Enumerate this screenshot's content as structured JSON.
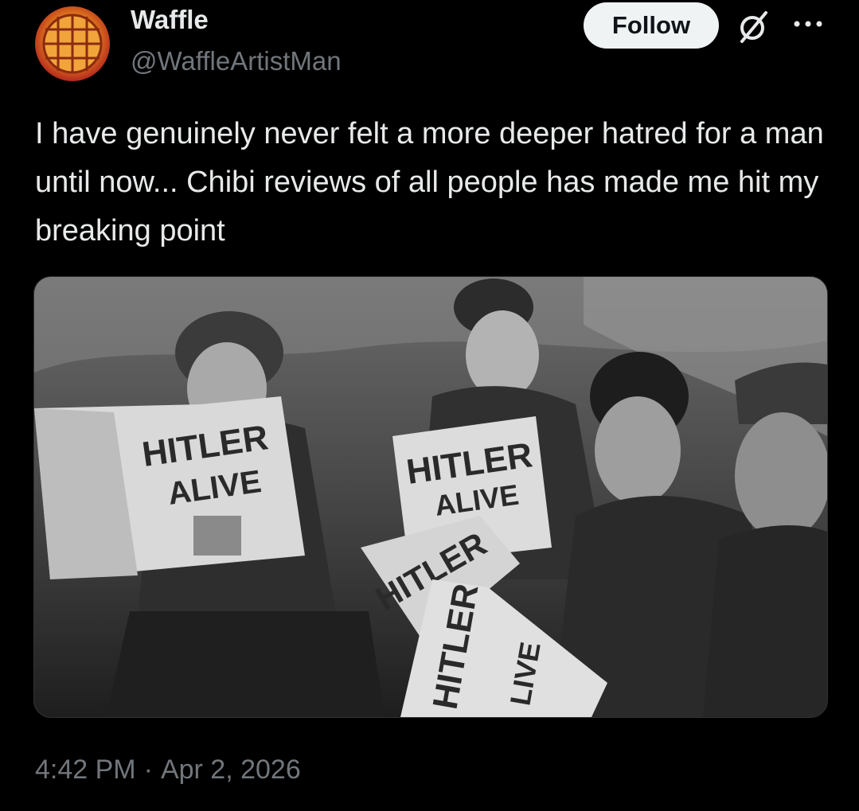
{
  "author": {
    "display_name": "Waffle",
    "handle": "@WaffleArtistMan",
    "avatar_icon": "waffle-icon"
  },
  "actions": {
    "follow_label": "Follow",
    "grok_icon": "grok-icon",
    "more_icon": "more-options-icon"
  },
  "tweet": {
    "text": "I have genuinely never felt a more deeper hatred for a man until now... Chibi reviews of all people has made me hit my breaking point",
    "time": "4:42 PM",
    "date": "Apr 2, 2026"
  },
  "media": {
    "newspaper_headline_1": "HITLER",
    "newspaper_headline_2": "ALIVE",
    "newspaper_headline_3": "HITLER",
    "newspaper_headline_4": "ALIVE",
    "newspaper_headline_5": "HITLER",
    "newspaper_headline_6": "HITLER",
    "newspaper_headline_7": "LIVE"
  },
  "colors": {
    "background": "#000000",
    "text_primary": "#e7e9ea",
    "text_secondary": "#71767b",
    "follow_bg": "#eff3f4"
  }
}
